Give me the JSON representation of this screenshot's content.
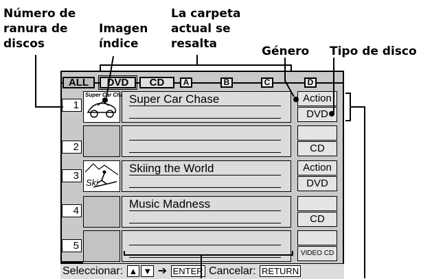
{
  "callouts": {
    "slot_number": [
      "Número de",
      "ranura de",
      "discos"
    ],
    "index_image": [
      "Imagen",
      "índice"
    ],
    "current_folder": [
      "La carpeta",
      "actual se",
      "resalta"
    ],
    "genre": "Género",
    "disc_type": "Tipo de disco"
  },
  "tabs": {
    "all": "ALL",
    "dvd": "DVD",
    "cd": "CD",
    "a": "A",
    "b": "B",
    "c": "C",
    "d": "D"
  },
  "slots": [
    {
      "number": "1",
      "title": "Super Car Chase",
      "genre": "Action",
      "type": "DVD",
      "thumb_caption": "Super Car Chase"
    },
    {
      "number": "2",
      "title": "",
      "genre": "",
      "type": "CD",
      "thumb_caption": ""
    },
    {
      "number": "3",
      "title": "Skiing the World",
      "genre": "Action",
      "type": "DVD",
      "thumb_caption": "Ski"
    },
    {
      "number": "4",
      "title": "Music Madness",
      "genre": "",
      "type": "CD",
      "thumb_caption": ""
    },
    {
      "number": "5",
      "title": "",
      "genre": "",
      "type": "VIDEO CD",
      "thumb_caption": ""
    }
  ],
  "status": {
    "select_label": "Seleccionar:",
    "enter_key": "ENTER",
    "cancel_label": "Cancelar:",
    "return_key": "RETURN"
  }
}
